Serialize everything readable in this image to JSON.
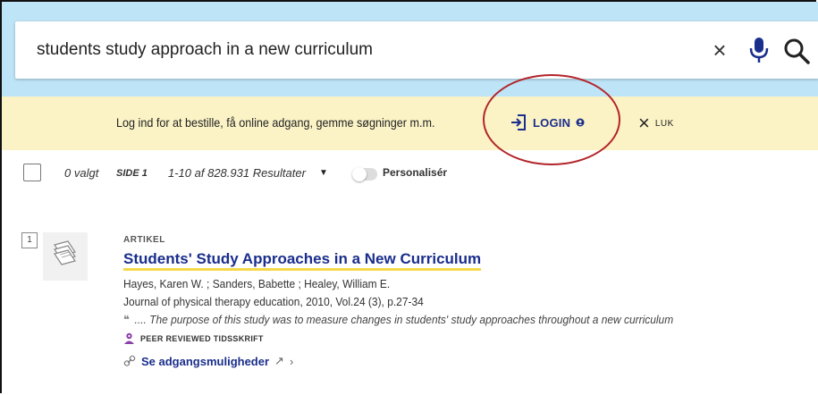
{
  "search": {
    "query": "students study approach in a new curriculum"
  },
  "login_bar": {
    "message": "Log ind for at bestille, få online adgang, gemme søgninger m.m.",
    "login_label": "LOGIN",
    "close_label": "LUK"
  },
  "toolbar": {
    "selected": "0 valgt",
    "page": "SIDE 1",
    "results": "1-10 af 828.931 Resultater",
    "personalise": "Personalisér"
  },
  "result": {
    "number": "1",
    "type": "ARTIKEL",
    "title": "Students' Study Approaches in a New Curriculum",
    "authors": "Hayes, Karen W. ; Sanders, Babette ; Healey, William E.",
    "journal": "Journal of physical therapy education, 2010, Vol.24 (3), p.27-34",
    "snippet": ".... The purpose of this study was to measure changes in students' study approaches throughout a new curriculum",
    "peer_reviewed": "PEER REVIEWED TIDSSKRIFT",
    "access_label": "Se adgangsmuligheder"
  },
  "colors": {
    "search_band": "#bee4f7",
    "login_bar": "#fbf3c6",
    "link": "#1a2e8c",
    "title_underline": "#f3d84a",
    "annotation": "#b3242a",
    "peer_icon": "#8b3fa8"
  }
}
